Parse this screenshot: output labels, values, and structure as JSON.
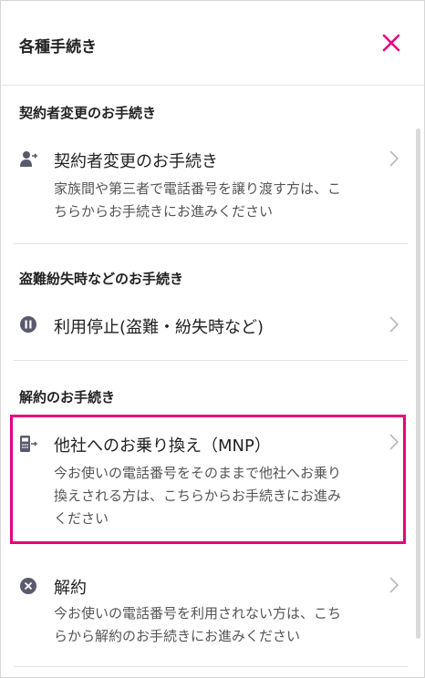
{
  "header": {
    "title": "各種手続き",
    "close_icon": "close-icon",
    "close_color": "#e6007e"
  },
  "sections": [
    {
      "title": "契約者変更のお手続き",
      "items": [
        {
          "icon": "person-transfer-icon",
          "label": "契約者変更のお手続き",
          "desc_lines": [
            "家族間や第三者で電話番号を譲り渡す方は、こ",
            "ちらからお手続きにお進みください"
          ]
        }
      ]
    },
    {
      "title": "盗難紛失時などのお手続き",
      "items": [
        {
          "icon": "pause-icon",
          "label": "利用停止(盗難・紛失時など)",
          "desc_lines": []
        }
      ]
    },
    {
      "title": "解約のお手続き",
      "items": [
        {
          "icon": "phone-transfer-icon",
          "label": "他社へのお乗り換え（MNP）",
          "desc_lines": [
            "今お使いの電話番号をそのままで他社へお乗り",
            "換えされる方は、こちらからお手続きにお進み",
            "ください"
          ],
          "highlighted": true
        },
        {
          "icon": "cancel-icon",
          "label": "解約",
          "desc_lines": [
            "今お使いの電話番号を利用されない方は、こち",
            "らから解約のお手続きにお進みください"
          ]
        }
      ]
    }
  ],
  "colors": {
    "accent": "#e6007e",
    "icon": "#5a5a6e",
    "chevron": "#b8b8b8"
  }
}
